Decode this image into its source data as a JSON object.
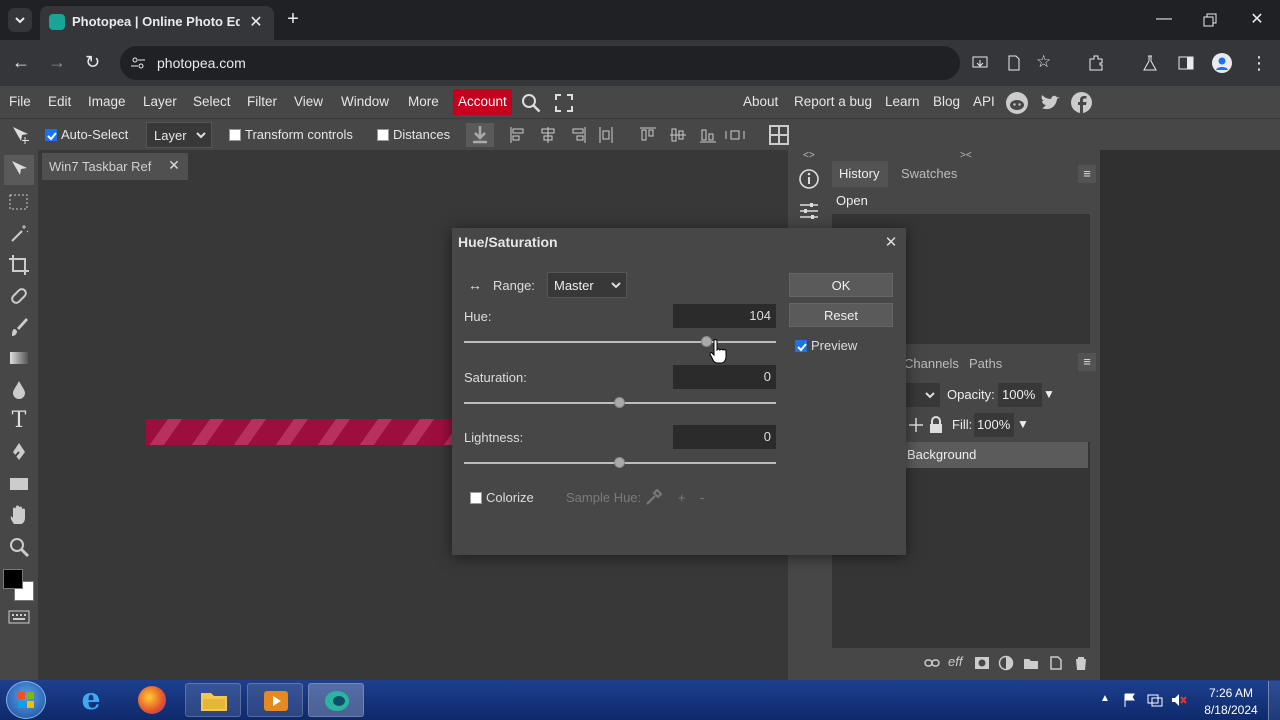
{
  "browser": {
    "tab_title": "Photopea | Online Photo Editor",
    "url": "photopea.com"
  },
  "menubar": {
    "items": [
      "File",
      "Edit",
      "Image",
      "Layer",
      "Select",
      "Filter",
      "View",
      "Window",
      "More"
    ],
    "account": "Account",
    "links": [
      "About",
      "Report a bug",
      "Learn",
      "Blog",
      "API"
    ]
  },
  "options": {
    "auto_select": "Auto-Select",
    "layer_select": "Layer",
    "transform_controls": "Transform controls",
    "distances": "Distances"
  },
  "document": {
    "tab_title": "Win7 Taskbar Ref"
  },
  "panels": {
    "history_tab": "History",
    "swatches_tab": "Swatches",
    "history_items": [
      "Open"
    ],
    "channels_tab": "Channels",
    "paths_tab": "Paths",
    "opacity_label": "Opacity:",
    "opacity_value": "100%",
    "fill_label": "Fill:",
    "fill_value": "100%",
    "layer_name": "Background"
  },
  "dialog": {
    "title": "Hue/Saturation",
    "range_label": "Range:",
    "range_value": "Master",
    "hue_label": "Hue:",
    "hue_value": "104",
    "hue_fraction": 0.78,
    "saturation_label": "Saturation:",
    "saturation_value": "0",
    "saturation_fraction": 0.5,
    "lightness_label": "Lightness:",
    "lightness_value": "0",
    "lightness_fraction": 0.5,
    "colorize_label": "Colorize",
    "sample_hue_label": "Sample Hue:",
    "plus": "+",
    "minus": "-",
    "ok": "OK",
    "reset": "Reset",
    "preview_label": "Preview"
  },
  "taskbar": {
    "time": "7:26 AM",
    "date": "8/18/2024"
  },
  "colors": {
    "accent": "#1a73e8",
    "account_bg": "#c4001e",
    "canvas_stripe": "#a01040"
  }
}
